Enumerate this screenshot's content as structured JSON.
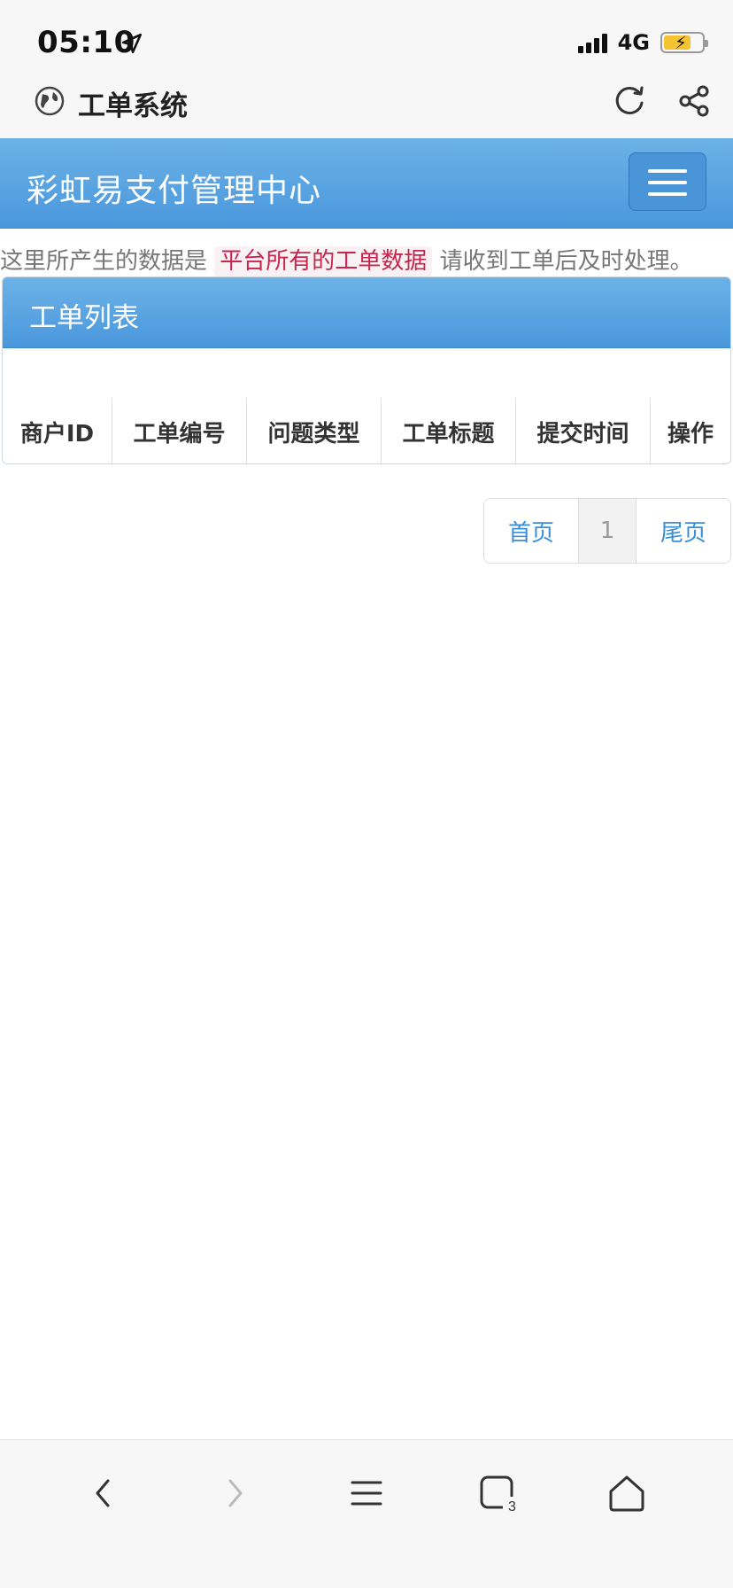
{
  "status": {
    "time": "05:10",
    "network": "4G",
    "icons": [
      "location-arrow-icon",
      "signal-icon",
      "battery-charging-icon"
    ]
  },
  "browser": {
    "title": "工单系统",
    "icons": [
      "globe-icon",
      "reload-icon",
      "share-icon"
    ]
  },
  "navbar": {
    "brand": "彩虹易支付管理中心",
    "toggle_icon": "menu-icon"
  },
  "info": {
    "prefix": "这里所产生的数据是",
    "highlight": "平台所有的工单数据",
    "suffix": "请收到工单后及时处理。"
  },
  "panel": {
    "title": "工单列表",
    "columns": [
      "商户ID",
      "工单编号",
      "问题类型",
      "工单标题",
      "提交时间",
      "操作"
    ]
  },
  "pagination": {
    "first": "首页",
    "current": "1",
    "last": "尾页"
  },
  "toolbar": {
    "tab_count": "3",
    "icons": [
      "back-icon",
      "forward-icon",
      "menu-icon",
      "tabs-icon",
      "home-icon"
    ]
  },
  "colors": {
    "primary": "#4a97dd",
    "highlight_text": "#c7254e",
    "link": "#3a8fd6"
  }
}
